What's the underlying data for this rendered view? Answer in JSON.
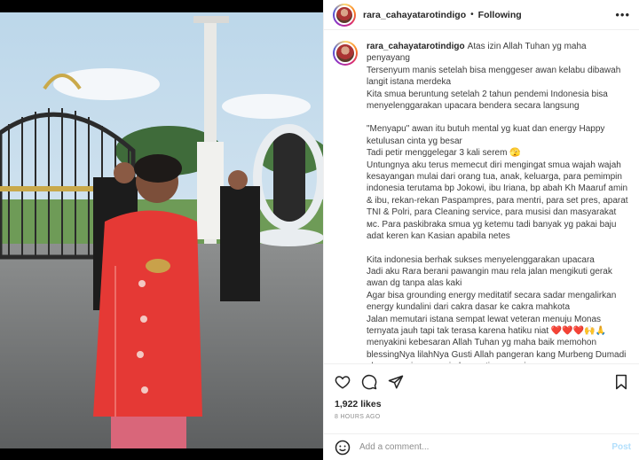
{
  "header": {
    "username": "rara_cahayatarotindigo",
    "separator": "•",
    "follow_status": "Following",
    "more": "•••"
  },
  "caption": {
    "username": "rara_cahayatarotindigo",
    "paragraphs": [
      "Atas izin Allah Tuhan yg maha penyayang\nTersenyum manis setelah bisa menggeser awan kelabu dibawah langit istana merdeka\nKita smua beruntung setelah 2 tahun pendemi Indonesia bisa menyelenggarakan upacara bendera secara langsung",
      "\"Menyapu\" awan itu butuh mental yg kuat dan energy Happy ketulusan cinta yg besar\nTadi petir menggelegar 3 kali serem 🫣\nUntungnya aku terus memecut diri mengingat smua wajah wajah kesayangan mulai dari orang tua, anak, keluarga, para pemimpin indonesia terutama bp Jokowi, ibu Iriana, bp abah Kh Maaruf amin & ibu, rekan-rekan Paspampres, para mentri, para set pres, aparat TNI & Polri, para Cleaning service, para musisi dan masyarakat ᴍᴄ. Para paskibraka smua yg ketemu tadi banyak yg pakai baju adat keren kan Kasian apabila netes",
      "Kita indonesia berhak sukses menyelenggarakan upacara\nJadi aku Rara berani pawangin mau rela jalan mengikuti gerak awan dg tanpa alas kaki\nAgar bisa grounding energy meditatif secara sadar mengalirkan energy kundalini dari cakra dasar ke cakra mahkota\nJalan memutari istana sempat lewat veteran menuju Monas ternyata jauh tapi tak terasa karena hatiku niat ❤️❤️❤️🙌🙏\nmenyakini kebesaran Allah Tuhan yg maha baik memohon blessingNya lilahNya Gusti Allah pangeran kang Murbeng Dumadi akan penaring mewujud seperti pas pagi upacara"
    ]
  },
  "stats": {
    "likes": "1,922 likes",
    "time_ago": "8 HOURS AGO"
  },
  "comment": {
    "placeholder": "Add a comment...",
    "post_label": "Post"
  },
  "icons": [
    "heart-icon",
    "comment-icon",
    "share-icon",
    "save-icon",
    "emoji-icon",
    "more-icon"
  ],
  "colors": {
    "dress": "#e53935",
    "post_disabled": "#b2dffc",
    "muted": "#8e8e8e"
  }
}
